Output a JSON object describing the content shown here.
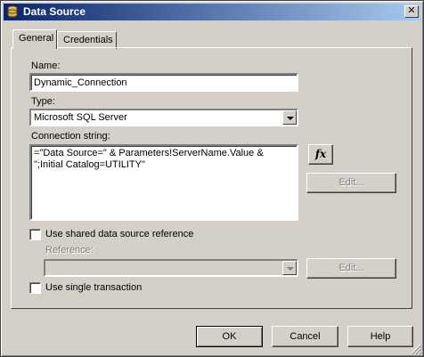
{
  "window": {
    "title": "Data Source"
  },
  "tabs": [
    {
      "label": "General"
    },
    {
      "label": "Credentials"
    }
  ],
  "general": {
    "name_label": "Name:",
    "name_value": "Dynamic_Connection",
    "type_label": "Type:",
    "type_value": "Microsoft SQL Server",
    "connection_label": "Connection string:",
    "connection_value": "=\"Data Source=\" & Parameters!ServerName.Value & \";Initial Catalog=UTILITY\"",
    "expression_button": "fx",
    "edit_button": "Edit...",
    "shared_checkbox_label": "Use shared data source reference",
    "shared_checked": false,
    "reference_label": "Reference:",
    "reference_value": "",
    "reference_edit_button": "Edit...",
    "single_transaction_label": "Use single transaction",
    "single_transaction_checked": false
  },
  "footer": {
    "ok": "OK",
    "cancel": "Cancel",
    "help": "Help"
  }
}
